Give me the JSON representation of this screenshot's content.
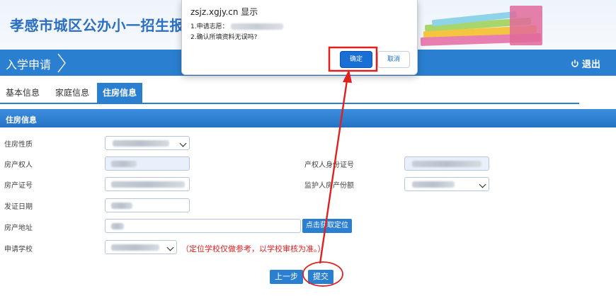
{
  "header": {
    "site_title": "孝感市城区公办小一招生报"
  },
  "nav": {
    "crumb": "入学申请",
    "logout_label": "退出"
  },
  "tabs": [
    "基本信息",
    "家庭信息",
    "住房信息"
  ],
  "section": {
    "title": "住房信息"
  },
  "form": {
    "housing_type_label": "住房性质",
    "owner_label": "房产权人",
    "owner_id_label": "产权人身份证号",
    "cert_no_label": "房产证号",
    "guardian_share_label": "监护人房产份额",
    "issue_date_label": "发证日期",
    "address_label": "房产地址",
    "locate_button": "点击获取定位",
    "school_label": "申请学校",
    "school_note": "（定位学校仅做参考，以学校审核为准。）"
  },
  "actions": {
    "prev_label": "上一步",
    "submit_label": "提交"
  },
  "dialog": {
    "host": "zsjz.xgjy.cn 显示",
    "line1": "1.申请志愿：",
    "line2": "2.确认所填资料无误吗?",
    "ok_label": "确定",
    "cancel_label": "取消"
  },
  "colors": {
    "brand_blue": "#2b7fd0",
    "annotation_red": "#e0201f"
  }
}
